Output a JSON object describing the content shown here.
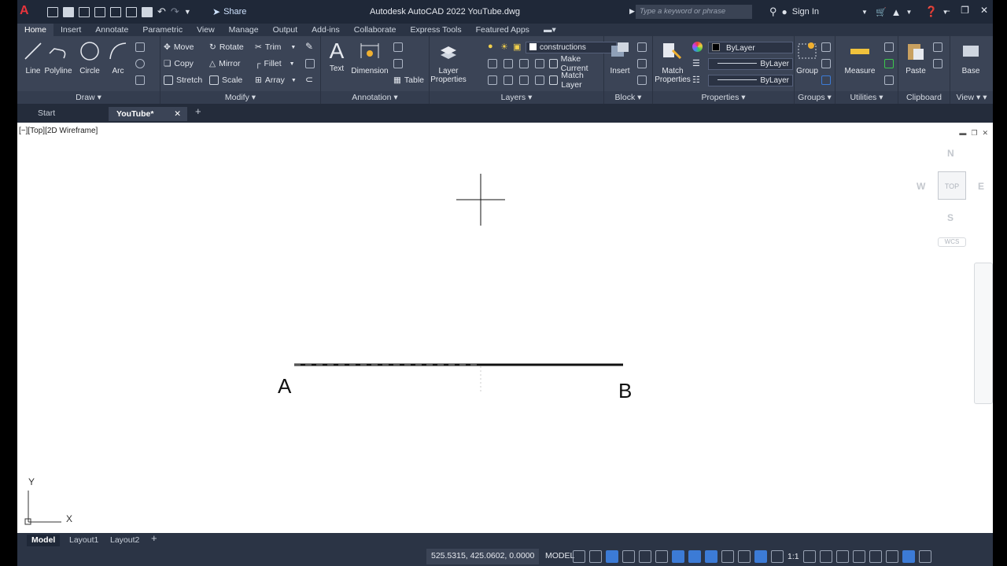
{
  "app": {
    "logo": "A",
    "title": "Autodesk AutoCAD 2022   YouTube.dwg",
    "share_label": "Share",
    "search_placeholder": "Type a keyword or phrase",
    "sign_in": "Sign In"
  },
  "ribbon_tabs": [
    "Home",
    "Insert",
    "Annotate",
    "Parametric",
    "View",
    "Manage",
    "Output",
    "Add-ins",
    "Collaborate",
    "Express Tools",
    "Featured Apps"
  ],
  "draw": {
    "title": "Draw",
    "line": "Line",
    "polyline": "Polyline",
    "circle": "Circle",
    "arc": "Arc"
  },
  "modify": {
    "title": "Modify",
    "move": "Move",
    "rotate": "Rotate",
    "trim": "Trim",
    "copy": "Copy",
    "mirror": "Mirror",
    "fillet": "Fillet",
    "stretch": "Stretch",
    "scale": "Scale",
    "array": "Array"
  },
  "annotation": {
    "title": "Annotation",
    "text": "Text",
    "dimension": "Dimension",
    "table": "Table"
  },
  "layers": {
    "title": "Layers",
    "layer_properties": "Layer Properties",
    "current_layer": "constructions",
    "make_current": "Make Current",
    "match_layer": "Match Layer"
  },
  "block": {
    "title": "Block",
    "insert": "Insert"
  },
  "properties": {
    "title": "Properties",
    "match_properties": "Match Properties",
    "color": "ByLayer",
    "linetype": "ByLayer",
    "lineweight": "ByLayer"
  },
  "groups": {
    "title": "Groups",
    "group": "Group"
  },
  "utilities": {
    "title": "Utilities",
    "measure": "Measure"
  },
  "clipboard": {
    "title": "Clipboard",
    "paste": "Paste"
  },
  "view": {
    "title": "View",
    "base": "Base"
  },
  "filetabs": {
    "start": "Start",
    "current": "YouTube*"
  },
  "viewport": {
    "label": "[−][Top][2D Wireframe]",
    "cube_face": "TOP",
    "north": "N",
    "south": "S",
    "east": "E",
    "west": "W",
    "wcs": "WCS",
    "point_a": "A",
    "point_b": "B",
    "ucs_x": "X",
    "ucs_y": "Y"
  },
  "layouts": [
    "Model",
    "Layout1",
    "Layout2"
  ],
  "status": {
    "coords": "525.5315, 425.0602, 0.0000",
    "model": "MODEL",
    "scale": "1:1"
  }
}
